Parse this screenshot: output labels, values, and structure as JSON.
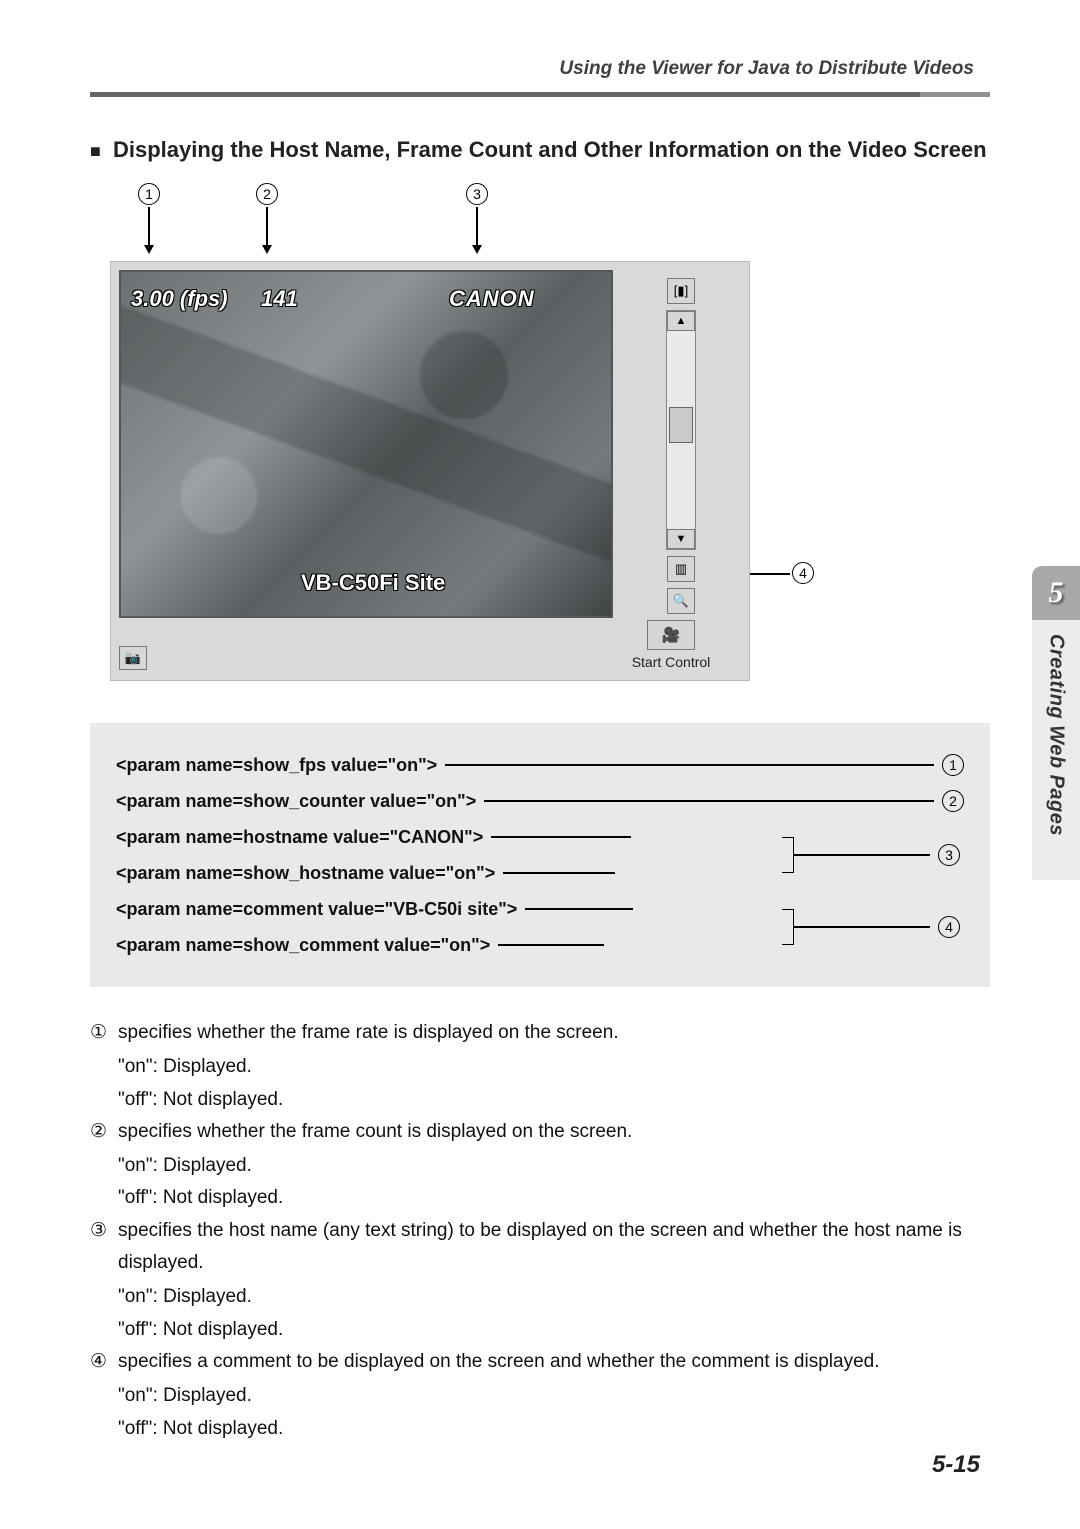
{
  "header": {
    "section_title": "Using the Viewer for Java to Distribute Videos"
  },
  "heading": "Displaying the Host Name, Frame Count and Other Information on the Video Screen",
  "callouts": {
    "c1": "1",
    "c2": "2",
    "c3": "3",
    "c4": "4"
  },
  "video_overlay": {
    "fps": "3.00 (fps)",
    "counter": "141",
    "hostname": "CANON",
    "comment": "VB-C50Fi Site"
  },
  "viewer": {
    "start_control": "Start Control",
    "slider_up": "▲",
    "slider_down": "▼",
    "bars_icon": "▥",
    "mag_icon": "🔍",
    "brackets_icon": "[▮]",
    "cam_icon": "📷",
    "start_icon": "🎥"
  },
  "params": {
    "p1": "<param name=show_fps value=\"on\">",
    "p2": "<param name=show_counter value=\"on\">",
    "p3a": "<param name=hostname value=\"CANON\">",
    "p3b": "<param name=show_hostname value=\"on\">",
    "p4a": "<param name=comment value=\"VB-C50i site\">",
    "p4b": "<param name=show_comment value=\"on\">"
  },
  "explanations": {
    "n1": "①",
    "n2": "②",
    "n3": "③",
    "n4": "④",
    "e1": "specifies whether the frame rate is displayed on the screen.",
    "e2": "specifies whether the frame count is displayed on the screen.",
    "e3": "specifies the host name (any text string) to be displayed on the screen and whether the host name is displayed.",
    "e4": "specifies a comment to be displayed on the screen and whether the comment is displayed.",
    "on": "\"on\": Displayed.",
    "off": "\"off\": Not displayed."
  },
  "side": {
    "chapter_num": "5",
    "chapter_title": "Creating Web Pages"
  },
  "footer": {
    "page_num": "5-15"
  }
}
